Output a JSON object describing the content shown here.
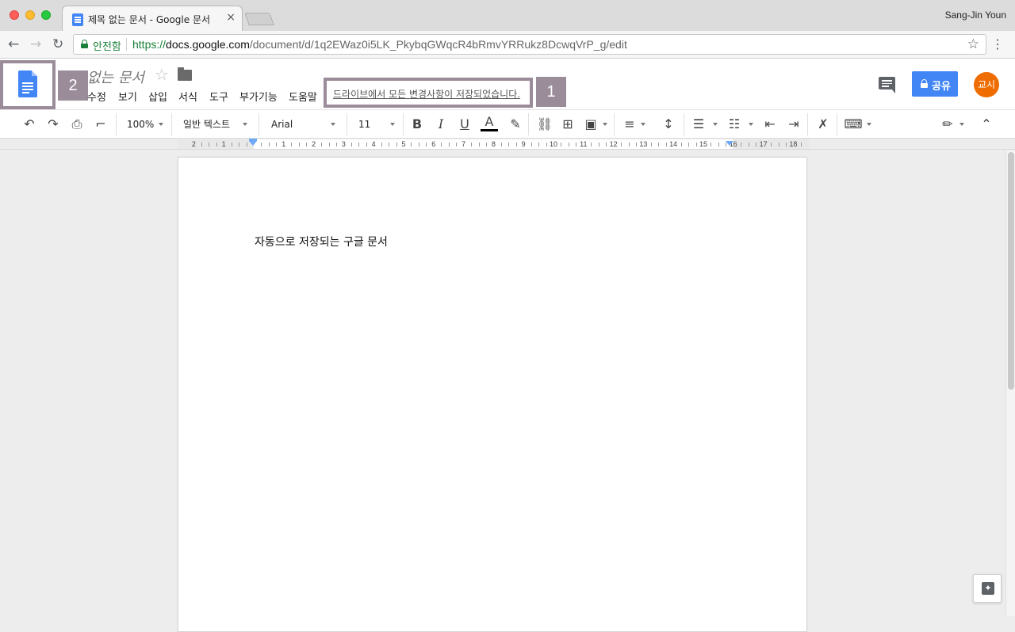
{
  "browser": {
    "tab_title": "제목 없는 문서 - Google 문서",
    "tab_close": "×",
    "profile_name": "Sang-Jin Youn",
    "secure_label": "안전함",
    "url_scheme": "https://",
    "url_host": "docs.google.com",
    "url_path": "/document/d/1q2EWaz0i5LK_PkybqGWqcR4bRmvYRRukz8DcwqVrP_g/edit",
    "back_icon": "arrow-left-icon",
    "forward_icon": "arrow-right-icon",
    "reload_icon": "reload-icon",
    "bookmark_icon": "star-icon",
    "menu_icon": "vertical-dots-icon"
  },
  "annotations": {
    "badge_1": "1",
    "badge_2": "2",
    "highlight_color": "#9a8c99"
  },
  "docs": {
    "title": "없는 문서",
    "menus": [
      "수정",
      "보기",
      "삽입",
      "서식",
      "도구",
      "부가기능",
      "도움말"
    ],
    "save_status": "드라이브에서 모든 변경사항이 저장되었습니다.",
    "share_label": "공유",
    "account_initials": "교시",
    "accent_color": "#4285f4",
    "avatar_color": "#ef6c00"
  },
  "toolbar": {
    "zoom": "100%",
    "style": "일반 텍스트",
    "font": "Arial",
    "font_size": "11",
    "bold": "B",
    "italic": "I",
    "underline": "U",
    "text_color": "A"
  },
  "ruler": {
    "numbers_left": [
      "2",
      "1"
    ],
    "numbers_right": [
      "1",
      "2",
      "3",
      "4",
      "5",
      "6",
      "7",
      "8",
      "9",
      "10",
      "11",
      "12",
      "13",
      "14",
      "15",
      "16",
      "17",
      "18"
    ]
  },
  "document": {
    "body_text": "자동으로 저장되는 구글 문서"
  }
}
